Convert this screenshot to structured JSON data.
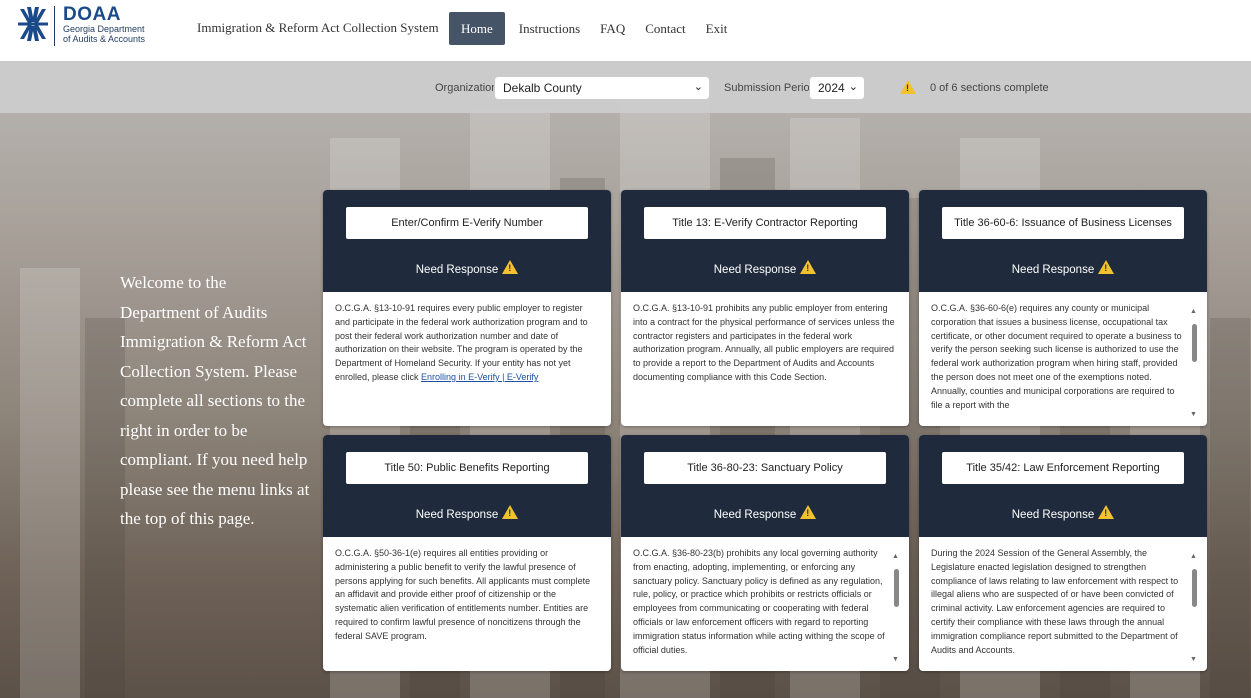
{
  "header": {
    "logo_title": "DOAA",
    "logo_subtitle_line1": "Georgia Department",
    "logo_subtitle_line2": "of Audits & Accounts",
    "app_title": "Immigration & Reform Act Collection System",
    "nav": {
      "home": "Home",
      "instructions": "Instructions",
      "faq": "FAQ",
      "contact": "Contact",
      "exit": "Exit"
    }
  },
  "filters": {
    "organization_label": "Organization:",
    "organization_value": "Dekalb County",
    "submission_period_label": "Submission Period:",
    "submission_period_value": "2024",
    "progress_text": "0 of 6 sections complete"
  },
  "welcome_text": "Welcome to the Department of Audits Immigration & Reform Act Collection System. Please complete all sections to the right in order to be compliant. If you need help please see the menu links at the top of this page.",
  "cards": [
    {
      "title": "Enter/Confirm E-Verify Number",
      "status": "Need Response",
      "body": "O.C.G.A. §13-10-91 requires every public employer to register and participate in the federal work authorization program and to post their federal work authorization number and date of authorization on their website. The program is operated by the Department of Homeland Security. If your entity has not yet enrolled, please click ",
      "link": "Enrolling in E-Verify | E-Verify"
    },
    {
      "title": "Title 13: E-Verify Contractor Reporting",
      "status": "Need Response",
      "body": "O.C.G.A. §13-10-91 prohibits any public employer from entering into a contract for the physical performance of services unless the contractor registers and participates in the federal work authorization program. Annually, all public employers are required to provide a report to the Department of Audits and Accounts documenting compliance with this Code Section."
    },
    {
      "title": "Title 36-60-6: Issuance of Business Licenses",
      "status": "Need Response",
      "body": "O.C.G.A. §36-60-6(e) requires any county or municipal corporation that issues a business license, occupational tax certificate, or other document required to operate a business to verify the person seeking such license is authorized to use the federal work authorization program when hiring staff, provided the person does not meet one of the exemptions noted. Annually, counties and municipal corporations are required to file a report with the"
    },
    {
      "title": "Title 50: Public Benefits Reporting",
      "status": "Need Response",
      "body": "O.C.G.A. §50-36-1(e) requires all entities providing or administering a public benefit to verify the lawful presence of persons applying for such benefits. All applicants must complete an affidavit and provide either proof of citizenship or the systematic alien verification of entitlements number. Entities are required to confirm lawful presence of noncitizens through the federal SAVE program."
    },
    {
      "title": "Title 36-80-23: Sanctuary Policy",
      "status": "Need Response",
      "body": "O.C.G.A. §36-80-23(b) prohibits any local governing authority from enacting, adopting, implementing, or enforcing any sanctuary policy. Sanctuary policy is defined as any regulation, rule, policy, or practice which prohibits or restricts officials or employees from communicating or cooperating with federal officials or law enforcement officers with regard to reporting immigration status information while acting withing the scope of official duties."
    },
    {
      "title": "Title 35/42: Law Enforcement Reporting",
      "status": "Need Response",
      "body": "During the 2024 Session of the General Assembly, the Legislature enacted legislation designed to strengthen compliance of laws relating to law enforcement with respect to illegal aliens who are suspected of or have been convicted of criminal activity. Law enforcement agencies are required to certify their compliance with these laws through the annual immigration compliance report submitted to the Department of Audits and Accounts."
    }
  ],
  "colors": {
    "card_header": "#1f2b3c",
    "nav_active": "#465468",
    "warning": "#f2c12e",
    "link": "#1a4fa3"
  },
  "icons": [
    "doaa-logo-icon",
    "warning-icon",
    "chevron-down-icon",
    "scroll-up-icon",
    "scroll-down-icon"
  ]
}
